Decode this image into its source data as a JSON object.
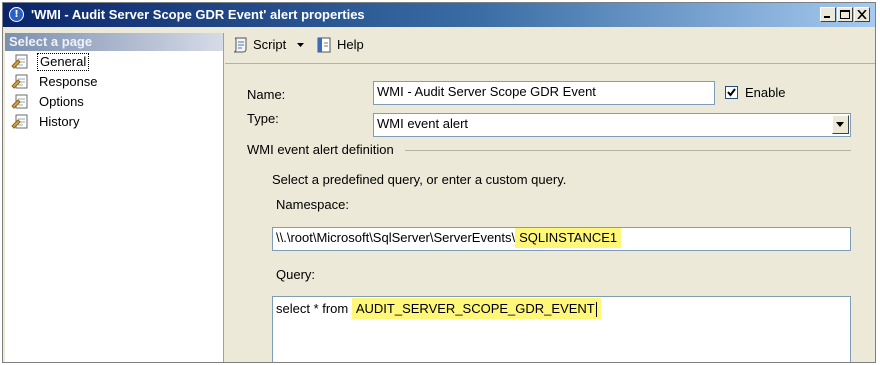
{
  "window": {
    "title": "'WMI - Audit Server Scope GDR Event' alert properties"
  },
  "sidebar": {
    "header": "Select a page",
    "items": [
      {
        "label": "General",
        "selected": true,
        "icon": "page-wrench-icon"
      },
      {
        "label": "Response",
        "selected": false,
        "icon": "page-wrench-icon"
      },
      {
        "label": "Options",
        "selected": false,
        "icon": "page-wrench-icon"
      },
      {
        "label": "History",
        "selected": false,
        "icon": "page-wrench-icon"
      }
    ]
  },
  "toolbar": {
    "script_label": "Script",
    "help_label": "Help"
  },
  "form": {
    "name_label": "Name:",
    "name_value": "WMI - Audit Server Scope GDR Event",
    "enable_label": "Enable",
    "enable_checked": true,
    "type_label": "Type:",
    "type_value": "WMI event alert",
    "group_label": "WMI event alert definition",
    "instruction": "Select a predefined query, or enter a custom query.",
    "namespace_label": "Namespace:",
    "namespace_prefix": "\\\\.\\root\\Microsoft\\SqlServer\\ServerEvents\\",
    "namespace_highlight": "SQLINSTANCE1",
    "query_label": "Query:",
    "query_prefix": "select * from ",
    "query_highlight": "AUDIT_SERVER_SCOPE_GDR_EVENT"
  },
  "colors": {
    "highlight": "#fff779",
    "title_bar_start": "#0a246a",
    "window_bg": "#ece9d8"
  }
}
